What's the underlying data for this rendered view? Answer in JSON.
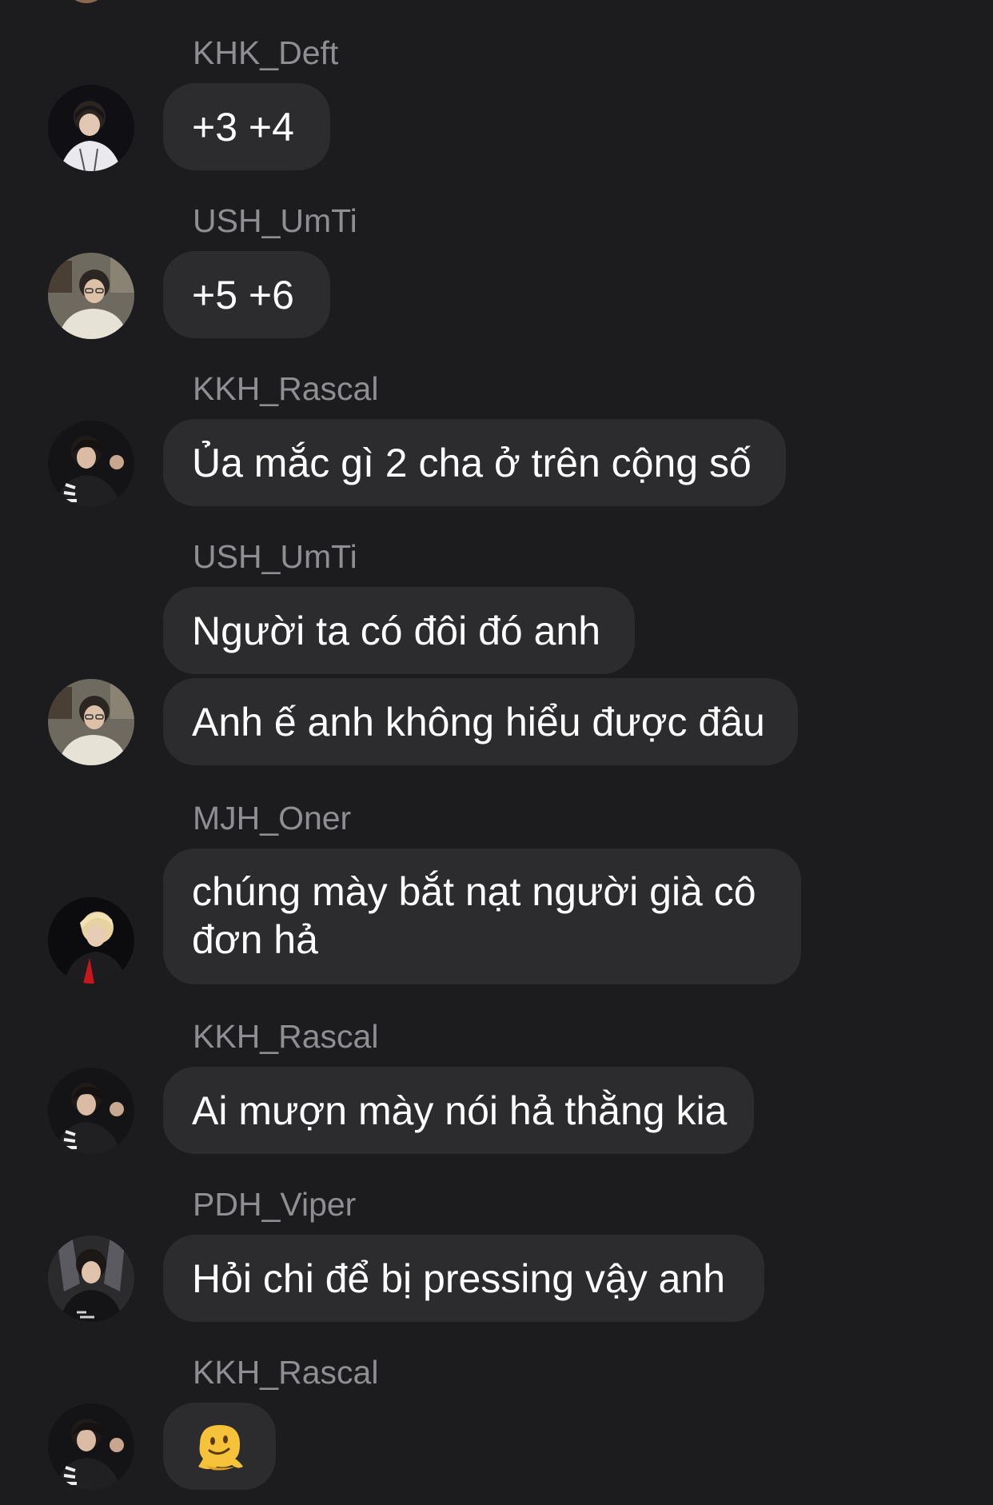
{
  "messages": [
    {
      "sender": "KHK_Deft",
      "texts": [
        "+3 +4"
      ],
      "avatar_icon": "deft-avatar-icon"
    },
    {
      "sender": "USH_UmTi",
      "texts": [
        "+5 +6"
      ],
      "avatar_icon": "umti-avatar-icon"
    },
    {
      "sender": "KKH_Rascal",
      "texts": [
        "Ủa mắc gì 2 cha ở trên cộng số"
      ],
      "avatar_icon": "rascal-avatar-icon"
    },
    {
      "sender": "USH_UmTi",
      "texts": [
        "Người ta có đôi đó anh",
        "Anh ế anh không hiểu được đâu"
      ],
      "avatar_icon": "umti-avatar-icon"
    },
    {
      "sender": "MJH_Oner",
      "texts": [
        "chúng mày bắt nạt người già cô đơn hả"
      ],
      "avatar_icon": "oner-avatar-icon"
    },
    {
      "sender": "KKH_Rascal",
      "texts": [
        "Ai mượn mày nói hả thằng kia"
      ],
      "avatar_icon": "rascal-avatar-icon"
    },
    {
      "sender": "PDH_Viper",
      "texts": [
        "Hỏi chi để bị pressing vậy anh"
      ],
      "avatar_icon": "viper-avatar-icon"
    },
    {
      "sender": "KKH_Rascal",
      "texts": [
        "🫠"
      ],
      "avatar_icon": "rascal-avatar-icon"
    }
  ],
  "colors": {
    "background": "#1c1c1e",
    "bubble": "#2c2c2e",
    "sender_name": "#8e8e93",
    "message_text": "#ffffff"
  }
}
